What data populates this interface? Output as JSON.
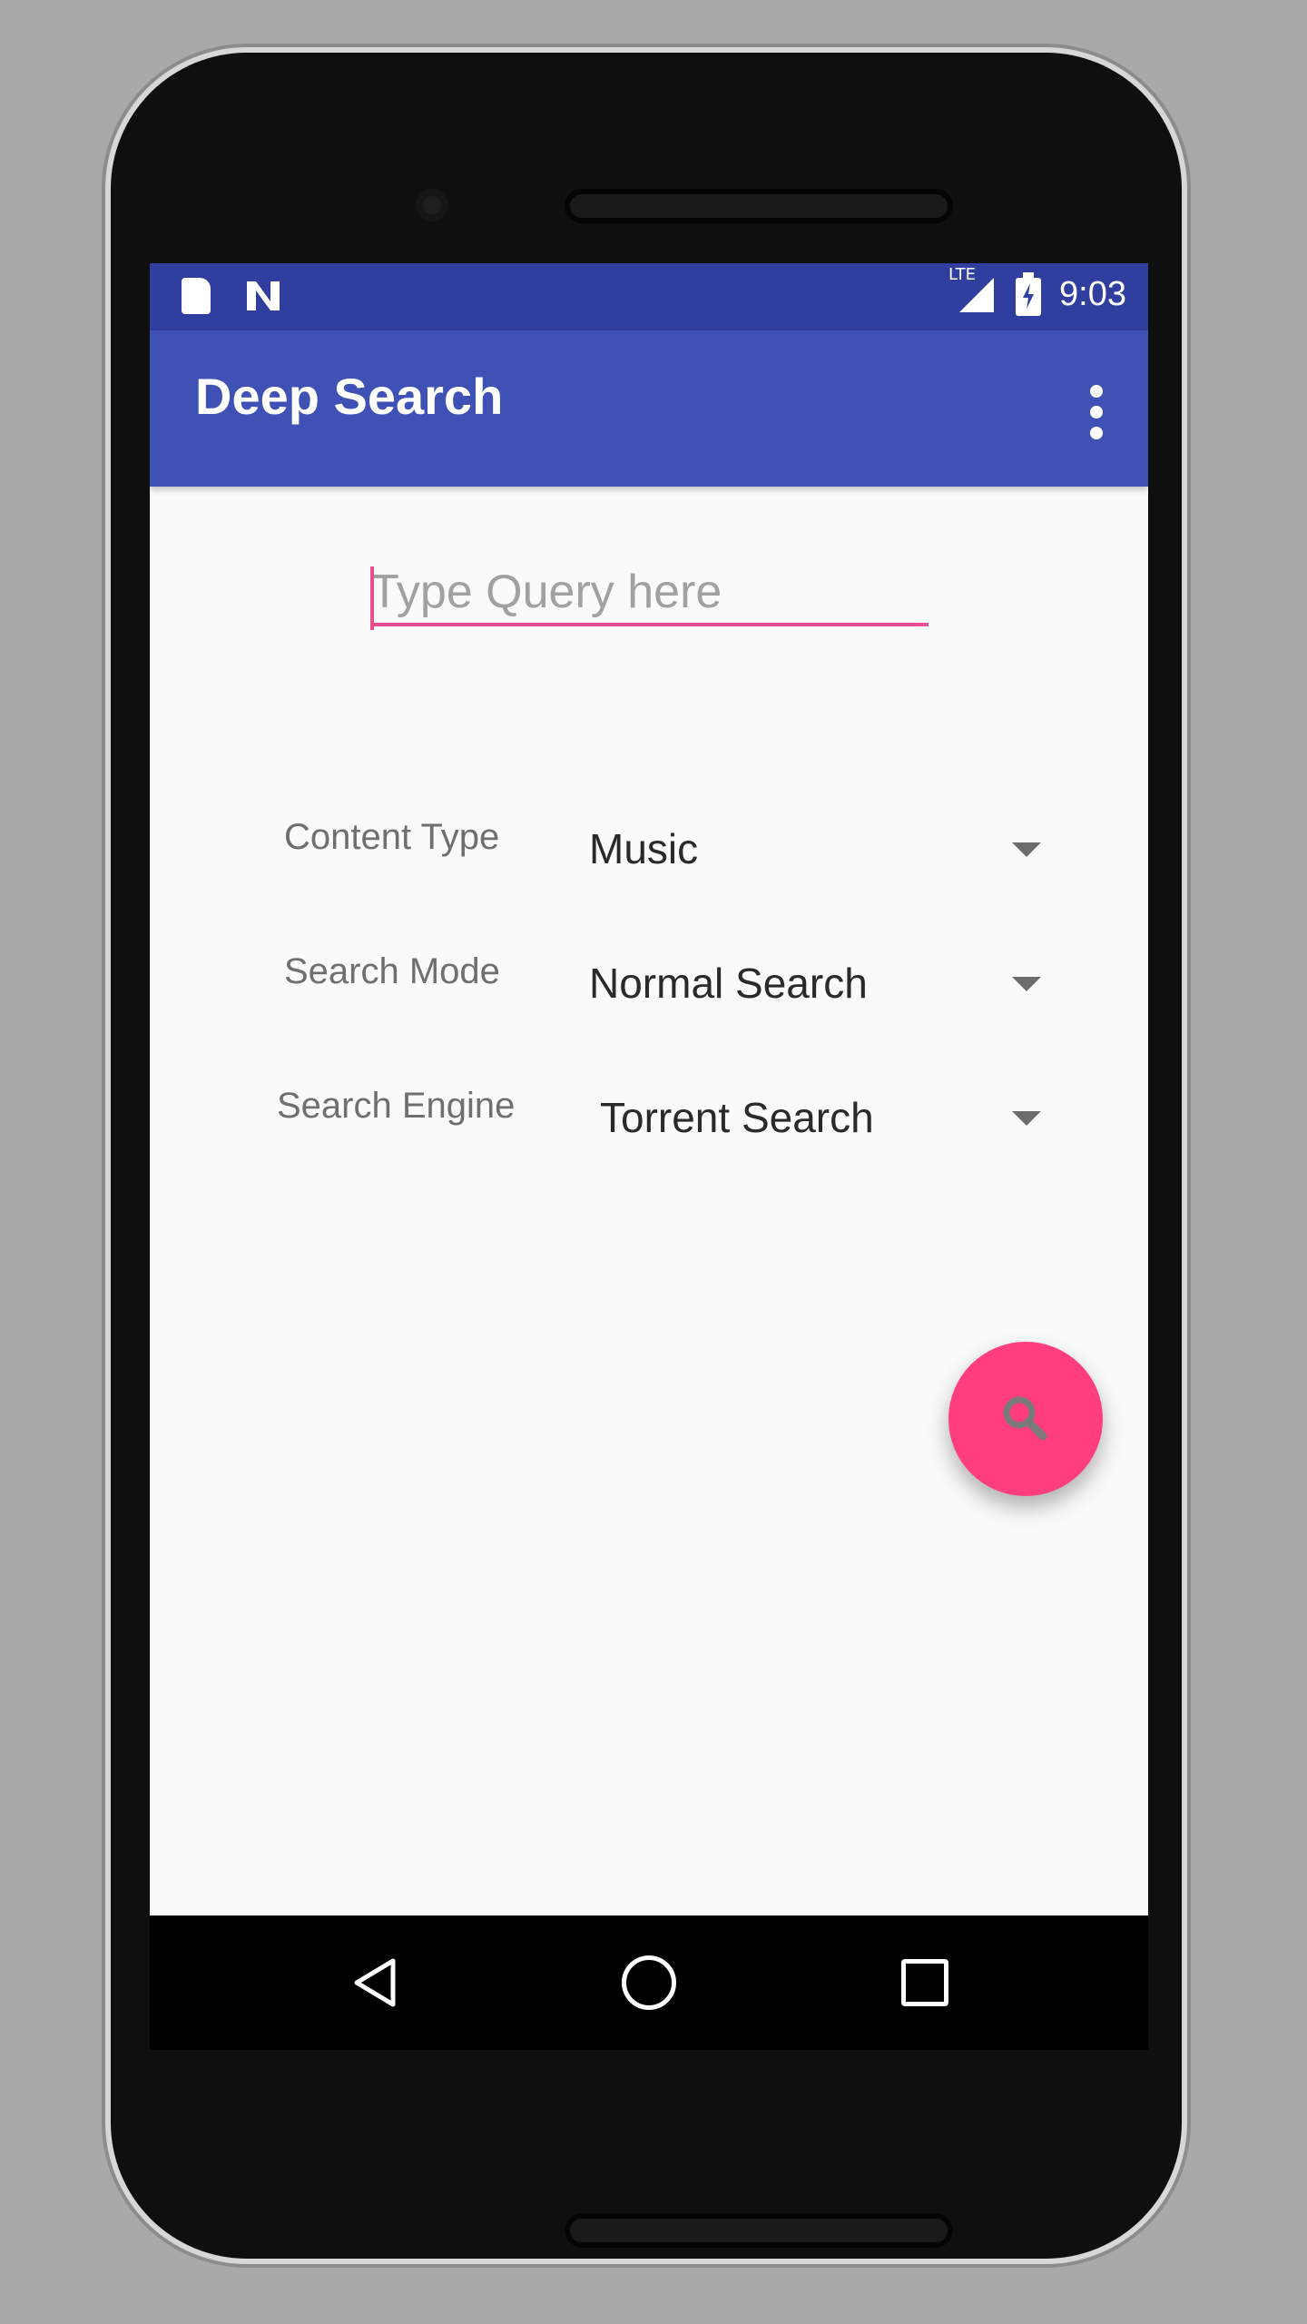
{
  "status_bar": {
    "time": "9:03",
    "network": "LTE",
    "icons": [
      "sd-card-icon",
      "n-notification-icon",
      "lte-signal-icon",
      "battery-charging-icon"
    ]
  },
  "app_bar": {
    "title": "Deep Search",
    "menu_icon": "more-vert-icon"
  },
  "query": {
    "placeholder": "Type Query here",
    "value": ""
  },
  "rows": [
    {
      "label": "Content Type",
      "value": "Music"
    },
    {
      "label": "Search Mode",
      "value": "Normal Search"
    },
    {
      "label": "Search Engine",
      "value": "Torrent Search"
    }
  ],
  "fab": {
    "icon": "search-icon"
  },
  "nav_bar": {
    "icons": [
      "back-icon",
      "home-icon",
      "recent-apps-icon"
    ]
  },
  "colors": {
    "status_bar": "#303f9f",
    "app_bar": "#3f51b5",
    "accent": "#ff3d7f",
    "input_line": "#e94f8c"
  }
}
